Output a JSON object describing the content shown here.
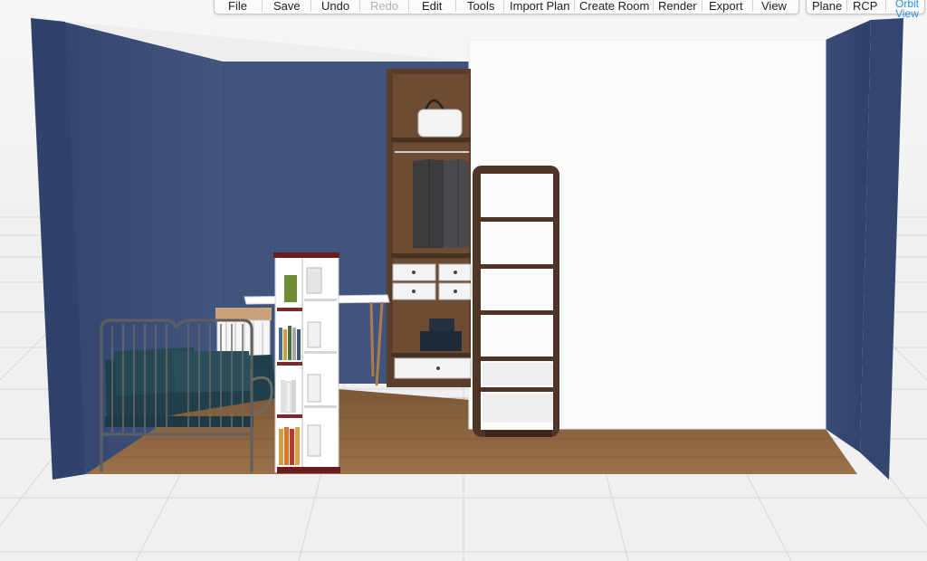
{
  "toolbar": {
    "items": [
      {
        "label": "File",
        "enabled": true
      },
      {
        "label": "Save",
        "enabled": true
      },
      {
        "label": "Undo",
        "enabled": true
      },
      {
        "label": "Redo",
        "enabled": false
      },
      {
        "label": "Edit",
        "enabled": true
      },
      {
        "label": "Tools",
        "enabled": true
      },
      {
        "label": "Import Plan",
        "enabled": true
      },
      {
        "label": "Create Room",
        "enabled": true
      },
      {
        "label": "Render",
        "enabled": true
      },
      {
        "label": "Export",
        "enabled": true
      },
      {
        "label": "View",
        "enabled": true
      }
    ]
  },
  "view_modes": {
    "items": [
      {
        "label": "Plane",
        "active": false
      },
      {
        "label": "RCP",
        "active": false
      },
      {
        "label": "Orbit View",
        "active": true
      }
    ]
  },
  "colors": {
    "wall_blue": "#3c4f7a",
    "wall_blue_dark": "#2f3f64",
    "floor_wood": "#8a6440",
    "white_wall": "#fbfbfa",
    "wardrobe_wood": "#5a3d2a",
    "accent_active": "#2b8fd8"
  }
}
